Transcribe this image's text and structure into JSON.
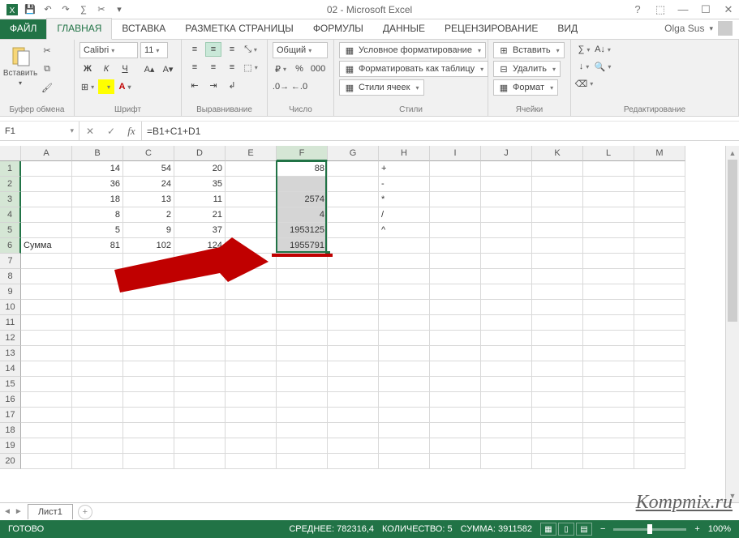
{
  "window_title": "02 - Microsoft Excel",
  "user": "Olga Sus",
  "tabs": {
    "file": "ФАЙЛ",
    "home": "ГЛАВНАЯ",
    "insert": "ВСТАВКА",
    "page": "РАЗМЕТКА СТРАНИЦЫ",
    "formulas": "ФОРМУЛЫ",
    "data": "ДАННЫЕ",
    "review": "РЕЦЕНЗИРОВАНИЕ",
    "view": "ВИД"
  },
  "ribbon": {
    "clipboard": {
      "paste": "Вставить",
      "label": "Буфер обмена"
    },
    "font": {
      "name": "Calibri",
      "size": "11",
      "label": "Шрифт",
      "bold": "Ж",
      "italic": "К",
      "underline": "Ч"
    },
    "align": {
      "label": "Выравнивание"
    },
    "number": {
      "format": "Общий",
      "label": "Число"
    },
    "styles": {
      "cond": "Условное форматирование",
      "table": "Форматировать как таблицу",
      "cell": "Стили ячеек",
      "label": "Стили"
    },
    "cells": {
      "insert": "Вставить",
      "delete": "Удалить",
      "format": "Формат",
      "label": "Ячейки"
    },
    "editing": {
      "label": "Редактирование"
    }
  },
  "name_box": "F1",
  "formula": "=B1+C1+D1",
  "columns": [
    "A",
    "B",
    "C",
    "D",
    "E",
    "F",
    "G",
    "H",
    "I",
    "J",
    "K",
    "L",
    "M"
  ],
  "rows": 20,
  "selected_col": "F",
  "selected_rows": [
    1,
    2,
    3,
    4,
    5,
    6
  ],
  "data_cells": {
    "A6": "Сумма",
    "B1": "14",
    "B2": "36",
    "B3": "18",
    "B4": "8",
    "B5": "5",
    "B6": "81",
    "C1": "54",
    "C2": "24",
    "C3": "13",
    "C4": "2",
    "C5": "9",
    "C6": "102",
    "D1": "20",
    "D2": "35",
    "D3": "11",
    "D4": "21",
    "D5": "37",
    "D6": "124",
    "F1": "88",
    "F3": "2574",
    "F4": "4",
    "F5": "1953125",
    "F6": "1955791",
    "H1": "+",
    "H2": "-",
    "H3": "*",
    "H4": "/",
    "H5": "^"
  },
  "numeric_cols": [
    "B",
    "C",
    "D",
    "F"
  ],
  "sheet_tab": "Лист1",
  "status": {
    "ready": "ГОТОВО",
    "avg_label": "СРЕДНЕЕ:",
    "avg_val": "782316,4",
    "count_label": "КОЛИЧЕСТВО:",
    "count_val": "5",
    "sum_label": "СУММА:",
    "sum_val": "3911582",
    "zoom": "100%"
  },
  "watermark": "Kompmix.ru"
}
